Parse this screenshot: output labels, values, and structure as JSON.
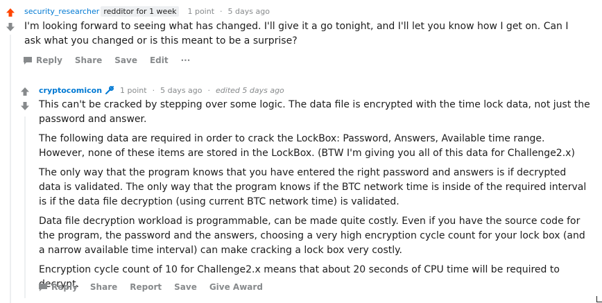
{
  "comment1": {
    "author": "security_researcher",
    "flair": "redditor for 1 week",
    "points": "1 point",
    "time": "5 days ago",
    "sep": "·",
    "body": "I'm looking forward to seeing what has changed. I'll give it a go tonight, and I'll let you know how I get on. Can I ask what you changed or is this meant to be a surprise?",
    "actions": {
      "reply": "Reply",
      "share": "Share",
      "save": "Save",
      "edit": "Edit",
      "more": "···"
    },
    "upvote_color": "#ff4500"
  },
  "comment2": {
    "author": "cryptocomicon",
    "points": "1 point",
    "time": "5 days ago",
    "edited": "edited 5 days ago",
    "sep": "·",
    "paragraphs": [
      "This can't be cracked by stepping over some logic. The data file is encrypted with the time lock data, not just the password and answer.",
      "The following data are required in order to crack the LockBox: Password, Answers, Available time range. However, none of these items are stored in the LockBox. (BTW I'm giving you all of this data for Challenge2.x)",
      "The only way that the program knows that you have entered the right password and answers is if decrypted data is validated. The only way that the program knows if the BTC network time is inside of the required interval is if the data file decryption (using current BTC network time) is validated.",
      "Data file decryption workload is programmable, can be made quite costly. Even if you have the source code for the program, the password and the answers, choosing a very high encryption cycle count for your lock box (and a narrow available time interval) can make cracking a lock box very costly.",
      "Encryption cycle count of 10 for Challenge2.x means that about 20 seconds of CPU time will be required to decrypt."
    ],
    "actions": {
      "reply": "Reply",
      "share": "Share",
      "report": "Report",
      "save": "Save",
      "give_award": "Give Award"
    }
  },
  "icons": {
    "upvote": "arrow-up-icon",
    "downvote": "arrow-down-icon",
    "reply": "comment-icon",
    "mod": "wrench-icon"
  }
}
